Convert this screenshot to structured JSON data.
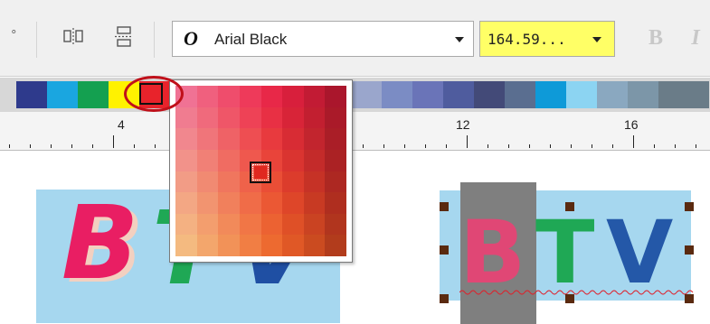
{
  "toolbar": {
    "font_glyph": "O",
    "font_name": "Arial Black",
    "font_size": "164.59...",
    "bold_label": "B",
    "italic_label": "I",
    "leading_symbol": "°"
  },
  "palette": {
    "swatches": [
      "#2e3a8c",
      "#1aa6e0",
      "#14a050",
      "#fff200",
      "#e8232b",
      "#9aa6cc",
      "#7b8cc4",
      "#6a74b8",
      "#4f5c9e",
      "#434a78",
      "#5a6e90",
      "#0e9ad8",
      "#8cd4f2",
      "#8aa8c0",
      "#7c96a8",
      "#6a7c88"
    ]
  },
  "ruler": {
    "labels": [
      "4",
      "12",
      "16"
    ]
  },
  "popup": {
    "colors": [
      [
        "#f07294",
        "#f0607e",
        "#ef4d6c",
        "#ee3a5a",
        "#e82848",
        "#d81f3c",
        "#c21b34",
        "#aa162c"
      ],
      [
        "#f07c90",
        "#f06a7c",
        "#ef5668",
        "#ee4256",
        "#e83044",
        "#d82438",
        "#c21f30",
        "#aa1a29"
      ],
      [
        "#f1878e",
        "#f0757a",
        "#ef6266",
        "#ee4e52",
        "#e83a3e",
        "#d82c34",
        "#c2252e",
        "#aa1e27"
      ],
      [
        "#f2928a",
        "#f18076",
        "#f06c62",
        "#ef584e",
        "#e9443a",
        "#da3430",
        "#c42b2a",
        "#ab2224"
      ],
      [
        "#f29c86",
        "#f18a72",
        "#f0765e",
        "#ef624a",
        "#ea4e36",
        "#dc3c2c",
        "#c63226",
        "#ad2822"
      ],
      [
        "#f3a784",
        "#f29470",
        "#f1805c",
        "#f06c48",
        "#eb5834",
        "#de4629",
        "#c83a23",
        "#af2e1f"
      ],
      [
        "#f4b182",
        "#f39e6e",
        "#f28a5a",
        "#f17646",
        "#ec6232",
        "#df5027",
        "#ca4322",
        "#b1351e"
      ],
      [
        "#f4ba80",
        "#f3a66c",
        "#f29258",
        "#f17e44",
        "#ed6a30",
        "#e05826",
        "#cb4b20",
        "#b23c1c"
      ]
    ]
  },
  "canvas": {
    "logo_left": {
      "letters": [
        "B",
        "T",
        "V"
      ],
      "colors": [
        "#e91e63",
        "#1fa855",
        "#1f4fa3"
      ],
      "shadow_color": "#f3d0c0",
      "bg": "#a6d7ef"
    },
    "logo_right": {
      "letters": [
        "B",
        "T",
        "V"
      ],
      "colors": [
        "#e04775",
        "#1fa855",
        "#2458a8"
      ],
      "bg": "#a6d7ef"
    }
  }
}
